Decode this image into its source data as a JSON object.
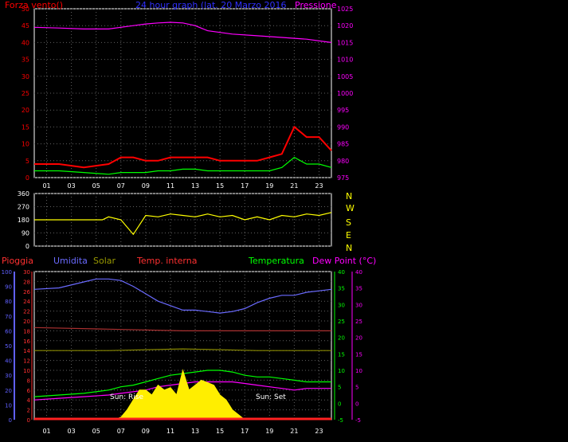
{
  "colors": {
    "wind": "#ff0000",
    "gust_bg": "#ff0000",
    "wind_avg": "#00ff00",
    "wind_speed": "#ffffff",
    "pressure": "#ff00ff",
    "title": "#4040ff",
    "direction": "#ffff00",
    "rain": "#6060ff",
    "humidity": "#6a6aff",
    "solar": "#ffee00",
    "solar_label": "#999900",
    "temp_int": "#ff4040",
    "temperature": "#00ff00",
    "dewpoint": "#ff00ff",
    "temp_int_line": "#aa3030",
    "solar_line": "#888800",
    "grid": "#606060"
  },
  "panel1": {
    "left_title": "Forza vento()",
    "center_title": "24 hour graph (lat. 20 Marzo 2016",
    "right_title": "Pressione"
  },
  "panel2": {
    "compass": [
      "N",
      "W",
      "S",
      "E",
      "N"
    ]
  },
  "panel3": {
    "labels": [
      "Pioggia",
      "Umidita",
      "Solar",
      "Temp. interna",
      "Temperatura",
      "Dew Point (°C)"
    ],
    "annotations": [
      "Sun: Rise",
      "Sun: Set"
    ]
  },
  "chart_data": [
    {
      "type": "line",
      "title": "24 hour graph (lat. 20 Marzo 2016",
      "x_ticks": [
        "01",
        "03",
        "05",
        "07",
        "09",
        "11",
        "13",
        "15",
        "17",
        "19",
        "21",
        "23"
      ],
      "y_left": {
        "label": "Forza vento()",
        "lim": [
          0,
          50
        ],
        "ticks": [
          0,
          5,
          10,
          15,
          20,
          25,
          30,
          35,
          40,
          45,
          50
        ]
      },
      "y_right": {
        "label": "Pressione",
        "lim": [
          975,
          1025
        ],
        "ticks": [
          975,
          980,
          985,
          990,
          995,
          1000,
          1005,
          1010,
          1015,
          1020,
          1025
        ]
      },
      "series": [
        {
          "name": "Pressione",
          "axis": "right",
          "x": [
            0,
            2,
            4,
            6,
            8,
            9,
            10,
            11,
            12,
            13,
            14,
            16,
            18,
            20,
            22,
            24
          ],
          "y": [
            1019.5,
            1019.3,
            1019,
            1019,
            1020,
            1020.5,
            1020.8,
            1021,
            1020.8,
            1020,
            1018.5,
            1017.5,
            1017,
            1016.5,
            1016,
            1015
          ]
        },
        {
          "name": "Raffica",
          "axis": "left",
          "x": [
            0,
            2,
            4,
            6,
            7,
            8,
            9,
            10,
            11,
            12,
            13,
            14,
            15,
            16,
            17,
            18,
            19,
            20,
            21,
            22,
            23,
            24
          ],
          "y": [
            4,
            4,
            3,
            4,
            6,
            6,
            5,
            5,
            6,
            6,
            6,
            6,
            5,
            5,
            5,
            5,
            6,
            7,
            15,
            12,
            12,
            8
          ]
        },
        {
          "name": "Media",
          "axis": "left",
          "x": [
            0,
            2,
            4,
            6,
            7,
            8,
            9,
            10,
            11,
            12,
            13,
            14,
            15,
            16,
            17,
            18,
            19,
            20,
            21,
            22,
            23,
            24
          ],
          "y": [
            2,
            2,
            1.5,
            1,
            1.5,
            1.5,
            1.5,
            2,
            2,
            2.5,
            2.5,
            2,
            2,
            2,
            2,
            2,
            2,
            3,
            6,
            4,
            4,
            3
          ]
        }
      ]
    },
    {
      "type": "line",
      "x_ticks": [
        "01",
        "03",
        "05",
        "07",
        "09",
        "11",
        "13",
        "15",
        "17",
        "19",
        "21",
        "23"
      ],
      "y_left": {
        "lim": [
          0,
          360
        ],
        "ticks": [
          0,
          90,
          180,
          270,
          360
        ]
      },
      "series": [
        {
          "name": "Direzione",
          "x": [
            0,
            5.5,
            6,
            7,
            8,
            9,
            10,
            11,
            12,
            13,
            14,
            15,
            16,
            17,
            18,
            19,
            20,
            21,
            22,
            23,
            24
          ],
          "y": [
            180,
            180,
            200,
            180,
            80,
            210,
            200,
            220,
            210,
            200,
            220,
            200,
            210,
            180,
            200,
            180,
            210,
            200,
            220,
            210,
            230
          ]
        }
      ]
    },
    {
      "type": "line",
      "x_ticks": [
        "01",
        "03",
        "05",
        "07",
        "09",
        "11",
        "13",
        "15",
        "17",
        "19",
        "21",
        "23"
      ],
      "y_rain": {
        "label": "Pioggia",
        "lim": [
          0,
          100
        ],
        "ticks": [
          0,
          10,
          20,
          30,
          40,
          50,
          60,
          70,
          80,
          90,
          100
        ]
      },
      "y_solar": {
        "label": "Solar",
        "lim": [
          0,
          30
        ],
        "ticks": [
          0,
          2,
          4,
          6,
          8,
          10,
          12,
          14,
          16,
          18,
          20,
          22,
          24,
          26,
          28,
          30
        ]
      },
      "y_temp": {
        "label": "Temperatura",
        "lim": [
          -5,
          40
        ],
        "ticks": [
          -5,
          0,
          5,
          10,
          15,
          20,
          25,
          30,
          35,
          40
        ]
      },
      "y_dew": {
        "label": "Dew Point (°C)",
        "lim": [
          -5,
          40
        ],
        "ticks": [
          -5,
          0,
          5,
          10,
          15,
          20,
          25,
          30,
          35,
          40
        ]
      },
      "series": [
        {
          "name": "Umidita",
          "axis": "rain",
          "x": [
            0,
            2,
            4,
            5,
            6,
            7,
            8,
            9,
            10,
            11,
            12,
            13,
            14,
            15,
            16,
            17,
            18,
            19,
            20,
            21,
            22,
            23,
            24
          ],
          "y": [
            88,
            89,
            93,
            95,
            95,
            94,
            90,
            85,
            80,
            77,
            74,
            74,
            73,
            72,
            73,
            75,
            79,
            82,
            84,
            84,
            86,
            87,
            88
          ]
        },
        {
          "name": "Temp. interna",
          "axis": "temp",
          "x": [
            0,
            6,
            12,
            18,
            24
          ],
          "y": [
            23,
            22.5,
            22,
            22,
            22
          ]
        },
        {
          "name": "Solar line",
          "axis": "temp",
          "x": [
            0,
            6,
            12,
            18,
            24
          ],
          "y": [
            16,
            16,
            16.5,
            16,
            16
          ]
        },
        {
          "name": "Temperatura",
          "axis": "temp",
          "x": [
            0,
            2,
            4,
            6,
            7,
            8,
            9,
            10,
            11,
            12,
            13,
            14,
            15,
            16,
            17,
            18,
            19,
            20,
            21,
            22,
            23,
            24
          ],
          "y": [
            2,
            2.5,
            3,
            4,
            5,
            5.5,
            6.5,
            7.5,
            8.5,
            9,
            9.5,
            10,
            10,
            9.5,
            8.5,
            8,
            8,
            7.5,
            7,
            6.5,
            6.5,
            6.5
          ]
        },
        {
          "name": "Dew Point",
          "axis": "dew",
          "x": [
            0,
            2,
            4,
            6,
            7,
            8,
            9,
            10,
            11,
            12,
            13,
            14,
            15,
            16,
            17,
            18,
            19,
            20,
            21,
            22,
            23,
            24
          ],
          "y": [
            1,
            1.5,
            2,
            2.5,
            3,
            3.5,
            4,
            5,
            5.5,
            6,
            6.5,
            6.5,
            6.5,
            6.5,
            6,
            5.5,
            5,
            4.5,
            4,
            4.5,
            4.5,
            4.5
          ]
        },
        {
          "name": "Solar",
          "axis": "solar",
          "x": [
            6.5,
            7,
            7.5,
            8,
            8.5,
            9,
            9.5,
            10,
            10.5,
            11,
            11.5,
            12,
            12.5,
            13,
            13.5,
            14,
            14.5,
            15,
            15.5,
            16,
            16.5,
            17
          ],
          "y": [
            0,
            0.5,
            2,
            4,
            6,
            6,
            5,
            7,
            6,
            6.5,
            5,
            10,
            6,
            7,
            8,
            7.5,
            7,
            5,
            4,
            2,
            1,
            0
          ]
        }
      ]
    }
  ]
}
